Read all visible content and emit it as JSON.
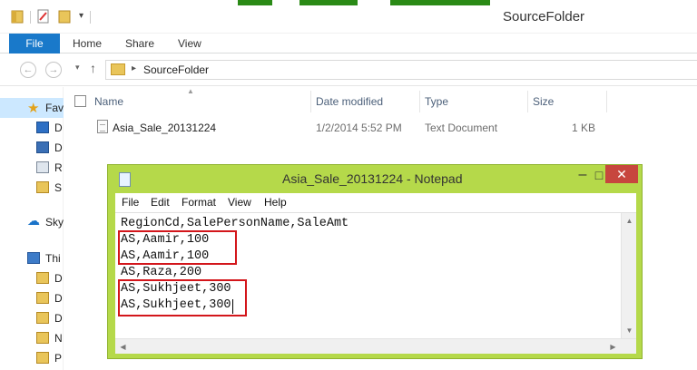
{
  "explorer": {
    "window_title": "SourceFolder",
    "tabs": {
      "file": "File",
      "home": "Home",
      "share": "Share",
      "view": "View"
    },
    "address": {
      "path": "SourceFolder"
    },
    "nav_items": [
      {
        "label": "Fav",
        "icon": "star-icon"
      },
      {
        "label": "D",
        "icon": "desktop-icon"
      },
      {
        "label": "D",
        "icon": "downloads-icon"
      },
      {
        "label": "R",
        "icon": "recent-places-icon"
      },
      {
        "label": "S",
        "icon": "folder-icon"
      },
      {
        "label": "Sky",
        "icon": "skydrive-cloud-icon"
      },
      {
        "label": "Thi",
        "icon": "computer-icon"
      },
      {
        "label": "D",
        "icon": "folder-icon"
      },
      {
        "label": "D",
        "icon": "folder-icon"
      },
      {
        "label": "D",
        "icon": "folder-icon"
      },
      {
        "label": "N",
        "icon": "music-icon"
      },
      {
        "label": "P",
        "icon": "pictures-icon"
      }
    ],
    "columns": {
      "name": "Name",
      "date": "Date modified",
      "type": "Type",
      "size": "Size"
    },
    "files": [
      {
        "name": "Asia_Sale_20131224",
        "date": "1/2/2014 5:52 PM",
        "type": "Text Document",
        "size": "1 KB"
      }
    ]
  },
  "notepad": {
    "title": "Asia_Sale_20131224 - Notepad",
    "menu": [
      "File",
      "Edit",
      "Format",
      "View",
      "Help"
    ],
    "lines": [
      "RegionCd,SalePersonName,SaleAmt",
      "AS,Aamir,100",
      "AS,Aamir,100",
      "AS,Raza,200",
      "AS,Sukhjeet,300",
      "AS,Sukhjeet,300"
    ],
    "close_symbol": "✕",
    "min_symbol": "–",
    "max_symbol": "□"
  },
  "colors": {
    "notepad_frame": "#b5d94a",
    "highlight_box": "#d3161b",
    "file_tab": "#1979ca"
  }
}
